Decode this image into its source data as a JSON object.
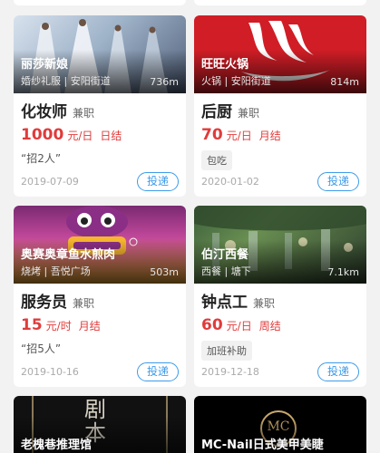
{
  "cards": [
    {
      "shop": "丽莎新娘",
      "meta": "婚纱礼服 | 安阳街道",
      "distance": "736m",
      "title": "化妆师",
      "job_type": "兼职",
      "pay": "1000",
      "unit": "元/日",
      "settle": "日结",
      "tag": "“招2人”",
      "date": "2019-07-09",
      "apply": "投递",
      "image_icon": "bridal-gown-photo"
    },
    {
      "shop": "旺旺火锅",
      "meta": "火锅 | 安阳街道",
      "distance": "814m",
      "title": "后厨",
      "job_type": "兼职",
      "pay": "70",
      "unit": "元/日",
      "settle": "月结",
      "tag": "包吃",
      "date": "2020-01-02",
      "apply": "投递",
      "image_icon": "hotpot-logo"
    },
    {
      "shop": "奥赛奥章鱼水煎肉",
      "meta": "烧烤 | 吾悦广场",
      "distance": "503m",
      "title": "服务员",
      "job_type": "兼职",
      "pay": "15",
      "unit": "元/时",
      "settle": "月结",
      "tag": "“招5人”",
      "date": "2019-10-16",
      "apply": "投递",
      "image_icon": "octopus-logo"
    },
    {
      "shop": "伯汀西餐",
      "meta": "西餐 | 塘下",
      "distance": "7.1km",
      "title": "钟点工",
      "job_type": "兼职",
      "pay": "60",
      "unit": "元/日",
      "settle": "周结",
      "tag": "加班补助",
      "date": "2019-12-18",
      "apply": "投递",
      "image_icon": "restaurant-interior-photo"
    },
    {
      "shop": "老槐巷推理馆",
      "logo_text": "剧本",
      "image_icon": "mystery-script-logo"
    },
    {
      "shop": "MC-Nail日式美甲美睫",
      "logo_text": "MC",
      "image_icon": "nail-salon-logo"
    }
  ],
  "colors": {
    "accent_red": "#e03b3b",
    "accent_blue": "#3d9be9",
    "hotpot_red": "#d11d26"
  }
}
